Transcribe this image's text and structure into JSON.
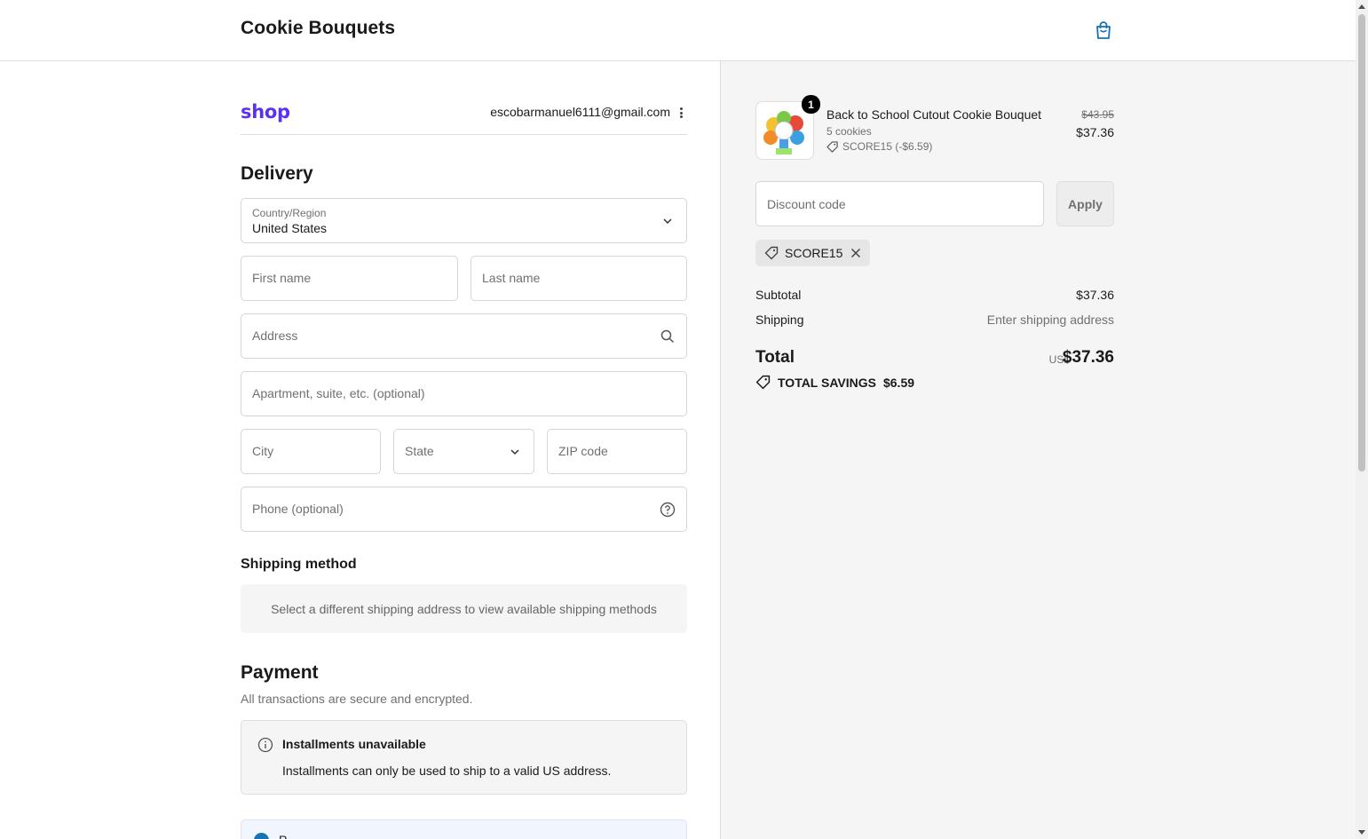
{
  "header": {
    "brand": "Cookie Bouquets",
    "cart_icon": "shopping-bag-icon",
    "accent": "#1773b0"
  },
  "shop": {
    "logo": "shop",
    "email": "escobarmanuel6111@gmail.com"
  },
  "delivery": {
    "title": "Delivery",
    "country_label": "Country/Region",
    "country_value": "United States",
    "first_name_placeholder": "First name",
    "last_name_placeholder": "Last name",
    "address_placeholder": "Address",
    "apartment_placeholder": "Apartment, suite, etc. (optional)",
    "city_placeholder": "City",
    "state_placeholder": "State",
    "zip_placeholder": "ZIP code",
    "phone_placeholder": "Phone (optional)"
  },
  "shipping": {
    "title": "Shipping method",
    "message": "Select a different shipping address to view available shipping methods"
  },
  "payment": {
    "title": "Payment",
    "subtitle": "All transactions are secure and encrypted.",
    "notice_title": "Installments unavailable",
    "notice_text": "Installments can only be used to ship to a valid US address.",
    "option_label": "P"
  },
  "order": {
    "item": {
      "name": "Back to School Cutout Cookie Bouquet",
      "variant": "5 cookies",
      "discount": "SCORE15 (-$6.59)",
      "quantity": "1",
      "original_price": "$43.95",
      "price": "$37.36"
    },
    "discount_placeholder": "Discount code",
    "apply_label": "Apply",
    "applied_code": "SCORE15",
    "subtotal_label": "Subtotal",
    "subtotal_value": "$37.36",
    "shipping_label": "Shipping",
    "shipping_value": "Enter shipping address",
    "total_label": "Total",
    "total_currency": "USD",
    "total_value": "$37.36",
    "savings_label": "TOTAL SAVINGS",
    "savings_value": "$6.59"
  }
}
